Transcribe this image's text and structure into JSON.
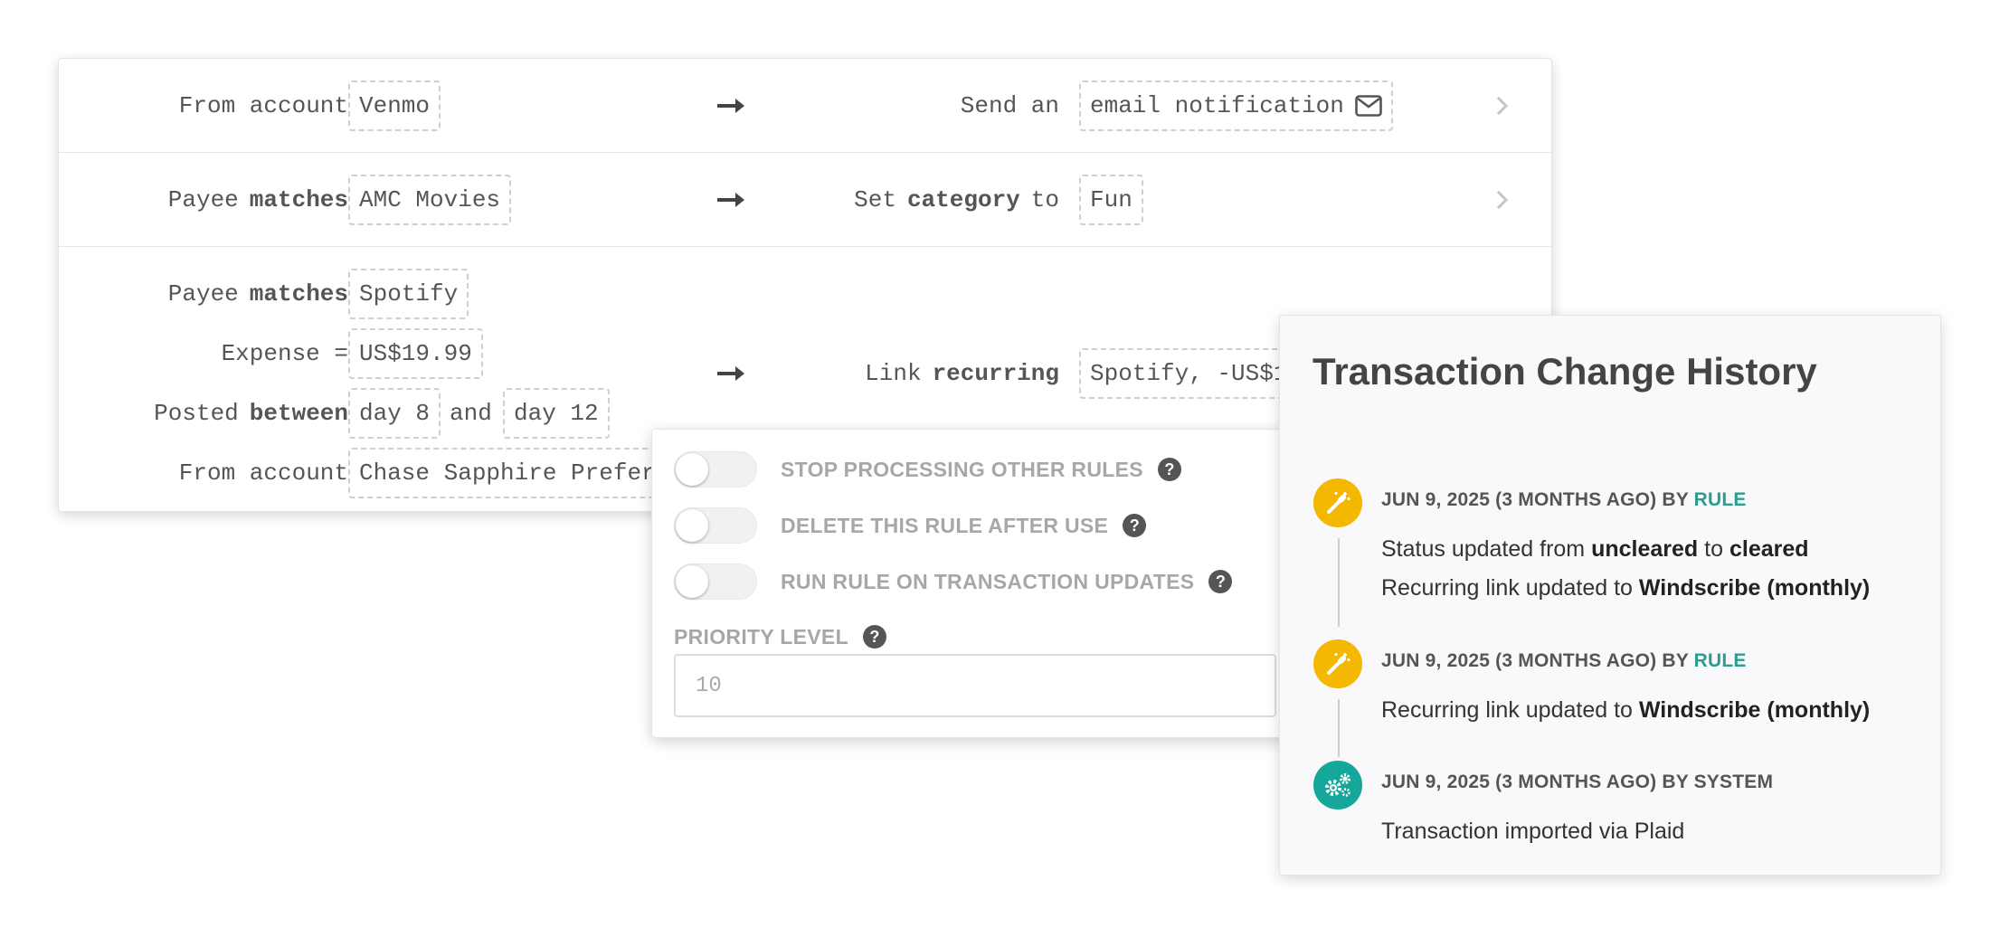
{
  "rules": {
    "row1": {
      "condition_label": "From account",
      "condition_value": "Venmo",
      "action_prefix": "Send an",
      "action_value": "email notification",
      "action_icon": "envelope-icon"
    },
    "row2": {
      "condition_word": "Payee",
      "condition_bold": "matches",
      "condition_value": "AMC Movies",
      "action_word": "Set",
      "action_bold": "category",
      "action_suffix": "to",
      "action_value": "Fun"
    },
    "row3": {
      "payee_word": "Payee",
      "payee_bold": "matches",
      "payee_value": "Spotify",
      "expense_label": "Expense =",
      "expense_value": "US$19.99",
      "posted_word": "Posted",
      "posted_bold": "between",
      "posted_from": "day 8",
      "posted_and": "and",
      "posted_to": "day 12",
      "account_label": "From account",
      "account_value": "Chase Sapphire Preferr",
      "action_word": "Link",
      "action_bold": "recurring",
      "action_value": "Spotify, -US$1"
    }
  },
  "options": {
    "stop_processing": {
      "label": "STOP PROCESSING OTHER RULES",
      "on": false
    },
    "delete_after_use": {
      "label": "DELETE THIS RULE AFTER USE",
      "on": false
    },
    "run_on_updates": {
      "label": "RUN RULE ON TRANSACTION UPDATES",
      "on": false
    },
    "priority_label": "PRIORITY LEVEL",
    "priority_placeholder": "10",
    "help_glyph": "?"
  },
  "history": {
    "title": "Transaction Change History",
    "events": [
      {
        "date": "JUN 9, 2025 (3 MONTHS AGO) BY",
        "by": "RULE",
        "icon": "magic-wand-icon",
        "icon_color": "#f5b800",
        "line1_prefix": "Status updated from",
        "line1_from": "uncleared",
        "line1_mid": "to",
        "line1_to": "cleared",
        "line2_prefix": "Recurring link updated to",
        "line2_value": "Windscribe (monthly)"
      },
      {
        "date": "JUN 9, 2025 (3 MONTHS AGO) BY",
        "by": "RULE",
        "icon": "magic-wand-icon",
        "icon_color": "#f5b800",
        "line1_prefix": "Recurring link updated to",
        "line1_value": "Windscribe (monthly)"
      },
      {
        "date": "JUN 9, 2025 (3 MONTHS AGO) BY SYSTEM",
        "icon": "gears-icon",
        "icon_color": "#15a89a",
        "line1": "Transaction imported via Plaid"
      }
    ]
  },
  "colors": {
    "accent_teal": "#2a9d8f",
    "rule_yellow": "#f5b800",
    "system_teal": "#15a89a"
  }
}
